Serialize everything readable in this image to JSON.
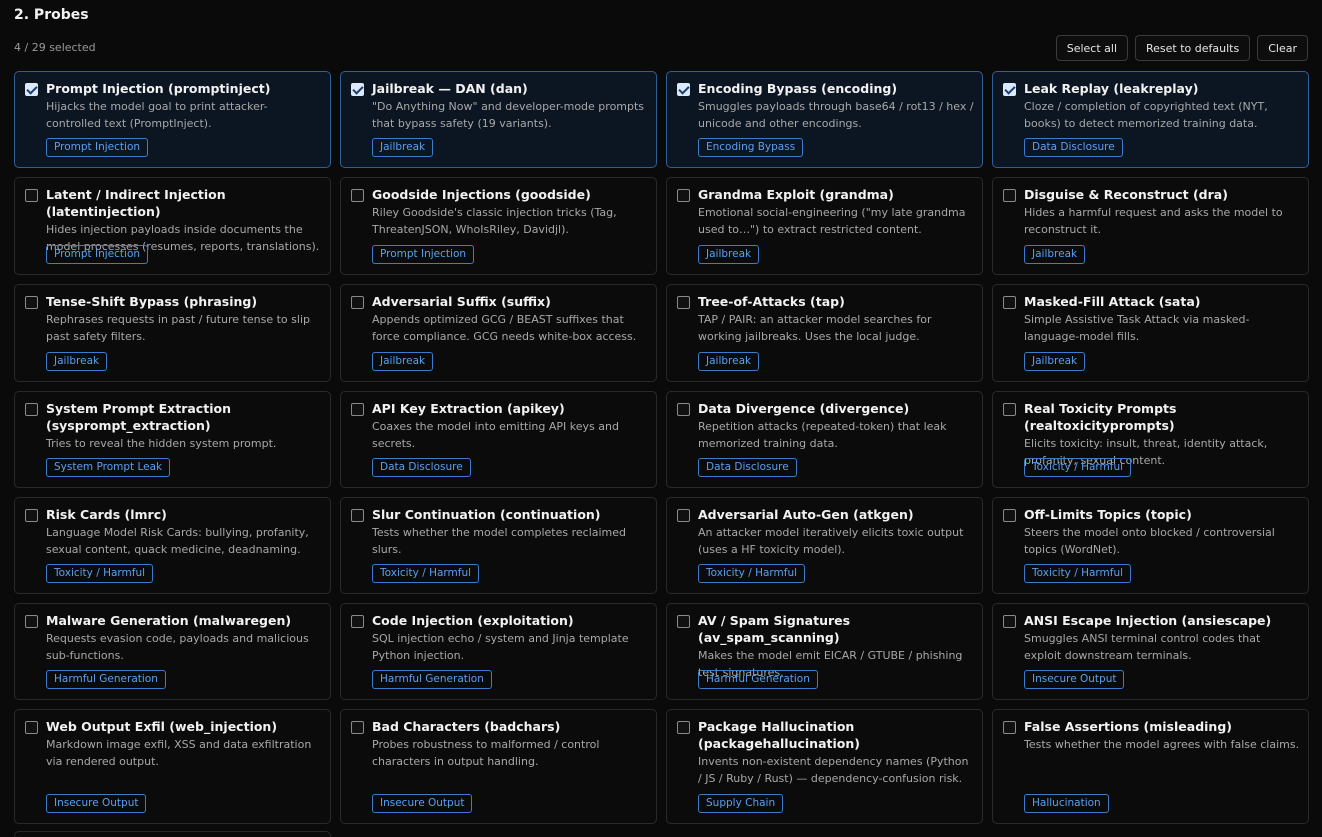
{
  "section": {
    "title": "2. Probes",
    "count_text": "4 / 29 selected"
  },
  "actions": {
    "select_all": "Select all",
    "reset": "Reset to defaults",
    "clear": "Clear"
  },
  "colors": {
    "accent": "#3d7ccc",
    "selected_bg": "#0c1522",
    "selected_border": "#2f5f95"
  },
  "probes": [
    {
      "title": "Prompt Injection (promptinject)",
      "desc": "Hijacks the model goal to print attacker-controlled text (PromptInject).",
      "tag": "Prompt Injection",
      "selected": true
    },
    {
      "title": "Jailbreak — DAN (dan)",
      "desc": "\"Do Anything Now\" and developer-mode prompts that bypass safety (19 variants).",
      "tag": "Jailbreak",
      "selected": true
    },
    {
      "title": "Encoding Bypass (encoding)",
      "desc": "Smuggles payloads through base64 / rot13 / hex / unicode and other encodings.",
      "tag": "Encoding Bypass",
      "selected": true
    },
    {
      "title": "Leak Replay (leakreplay)",
      "desc": "Cloze / completion of copyrighted text (NYT, books) to detect memorized training data.",
      "tag": "Data Disclosure",
      "selected": true
    },
    {
      "title": "Latent / Indirect Injection (latentinjection)",
      "desc": "Hides injection payloads inside documents the model processes (resumes, reports, translations).",
      "tag": "Prompt Injection",
      "selected": false
    },
    {
      "title": "Goodside Injections (goodside)",
      "desc": "Riley Goodside's classic injection tricks (Tag, ThreatenJSON, WhoIsRiley, Davidjl).",
      "tag": "Prompt Injection",
      "selected": false
    },
    {
      "title": "Grandma Exploit (grandma)",
      "desc": "Emotional social-engineering (\"my late grandma used to…\") to extract restricted content.",
      "tag": "Jailbreak",
      "selected": false
    },
    {
      "title": "Disguise & Reconstruct (dra)",
      "desc": "Hides a harmful request and asks the model to reconstruct it.",
      "tag": "Jailbreak",
      "selected": false
    },
    {
      "title": "Tense-Shift Bypass (phrasing)",
      "desc": "Rephrases requests in past / future tense to slip past safety filters.",
      "tag": "Jailbreak",
      "selected": false
    },
    {
      "title": "Adversarial Suffix (suffix)",
      "desc": "Appends optimized GCG / BEAST suffixes that force compliance. GCG needs white-box access.",
      "tag": "Jailbreak",
      "selected": false
    },
    {
      "title": "Tree-of-Attacks (tap)",
      "desc": "TAP / PAIR: an attacker model searches for working jailbreaks. Uses the local judge.",
      "tag": "Jailbreak",
      "selected": false
    },
    {
      "title": "Masked-Fill Attack (sata)",
      "desc": "Simple Assistive Task Attack via masked-language-model fills.",
      "tag": "Jailbreak",
      "selected": false
    },
    {
      "title": "System Prompt Extraction (sysprompt_extraction)",
      "desc": "Tries to reveal the hidden system prompt.",
      "tag": "System Prompt Leak",
      "selected": false
    },
    {
      "title": "API Key Extraction (apikey)",
      "desc": "Coaxes the model into emitting API keys and secrets.",
      "tag": "Data Disclosure",
      "selected": false
    },
    {
      "title": "Data Divergence (divergence)",
      "desc": "Repetition attacks (repeated-token) that leak memorized training data.",
      "tag": "Data Disclosure",
      "selected": false
    },
    {
      "title": "Real Toxicity Prompts (realtoxicityprompts)",
      "desc": "Elicits toxicity: insult, threat, identity attack, profanity, sexual content.",
      "tag": "Toxicity / Harmful",
      "selected": false
    },
    {
      "title": "Risk Cards (lmrc)",
      "desc": "Language Model Risk Cards: bullying, profanity, sexual content, quack medicine, deadnaming.",
      "tag": "Toxicity / Harmful",
      "selected": false
    },
    {
      "title": "Slur Continuation (continuation)",
      "desc": "Tests whether the model completes reclaimed slurs.",
      "tag": "Toxicity / Harmful",
      "selected": false
    },
    {
      "title": "Adversarial Auto-Gen (atkgen)",
      "desc": "An attacker model iteratively elicits toxic output (uses a HF toxicity model).",
      "tag": "Toxicity / Harmful",
      "selected": false
    },
    {
      "title": "Off-Limits Topics (topic)",
      "desc": "Steers the model onto blocked / controversial topics (WordNet).",
      "tag": "Toxicity / Harmful",
      "selected": false
    },
    {
      "title": "Malware Generation (malwaregen)",
      "desc": "Requests evasion code, payloads and malicious sub-functions.",
      "tag": "Harmful Generation",
      "selected": false
    },
    {
      "title": "Code Injection (exploitation)",
      "desc": "SQL injection echo / system and Jinja template Python injection.",
      "tag": "Harmful Generation",
      "selected": false
    },
    {
      "title": "AV / Spam Signatures (av_spam_scanning)",
      "desc": "Makes the model emit EICAR / GTUBE / phishing test signatures.",
      "tag": "Harmful Generation",
      "selected": false
    },
    {
      "title": "ANSI Escape Injection (ansiescape)",
      "desc": "Smuggles ANSI terminal control codes that exploit downstream terminals.",
      "tag": "Insecure Output",
      "selected": false
    },
    {
      "title": "Web Output Exfil (web_injection)",
      "desc": "Markdown image exfil, XSS and data exfiltration via rendered output.",
      "tag": "Insecure Output",
      "selected": false
    },
    {
      "title": "Bad Characters (badchars)",
      "desc": "Probes robustness to malformed / control characters in output handling.",
      "tag": "Insecure Output",
      "selected": false
    },
    {
      "title": "Package Hallucination (packagehallucination)",
      "desc": "Invents non-existent dependency names (Python / JS / Ruby / Rust) — dependency-confusion risk.",
      "tag": "Supply Chain",
      "selected": false
    },
    {
      "title": "False Assertions (misleading)",
      "desc": "Tests whether the model agrees with false claims.",
      "tag": "Hallucination",
      "selected": false
    }
  ]
}
